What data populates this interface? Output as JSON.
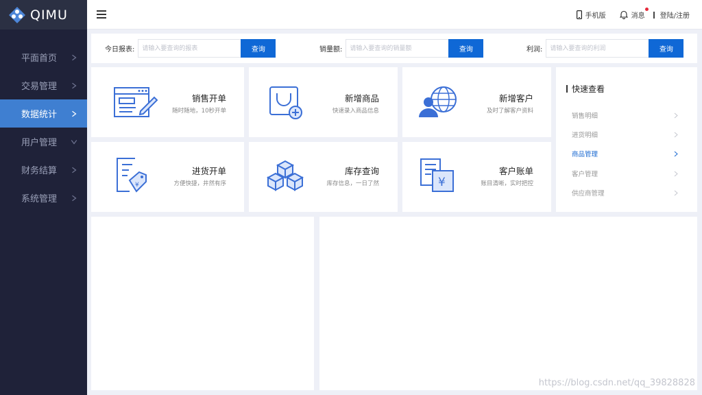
{
  "brand": {
    "name": "QIMU"
  },
  "sidebar": {
    "items": [
      {
        "label": "平面首页",
        "chevron": "right"
      },
      {
        "label": "交易管理",
        "chevron": "right"
      },
      {
        "label": "数据统计",
        "chevron": "right"
      },
      {
        "label": "用户管理",
        "chevron": "down"
      },
      {
        "label": "财务结算",
        "chevron": "right"
      },
      {
        "label": "系统管理",
        "chevron": "right"
      }
    ],
    "active_index": 2
  },
  "header": {
    "mobile_label": "手机版",
    "messages_label": "消息",
    "login_label": "登陆/注册"
  },
  "search": {
    "today_label": "今日报表:",
    "today_placeholder": "请输入要查询的报表",
    "sales_label": "销量额:",
    "sales_placeholder": "请输入要查询的销量额",
    "profit_label": "利润:",
    "profit_placeholder": "请输入要查询的利润",
    "button_label": "查询"
  },
  "cards": [
    {
      "title": "销售开单",
      "desc": "随时随地，10秒开单",
      "icon": "sales-order-icon"
    },
    {
      "title": "新增商品",
      "desc": "快速录入商品信息",
      "icon": "shopping-bag-add-icon"
    },
    {
      "title": "新增客户",
      "desc": "及时了解客户资料",
      "icon": "customer-globe-icon"
    },
    {
      "title": "进货开单",
      "desc": "方便快捷，井然有序",
      "icon": "purchase-tag-icon"
    },
    {
      "title": "库存查询",
      "desc": "库存信息，一日了然",
      "icon": "inventory-boxes-icon"
    },
    {
      "title": "客户账单",
      "desc": "账目清晰，实时把控",
      "icon": "customer-bill-icon"
    }
  ],
  "quick": {
    "title": "快速查看",
    "items": [
      "销售明细",
      "进货明细",
      "商品管理",
      "客户管理",
      "供应商管理"
    ],
    "active_index": 2
  },
  "watermark": "https://blog.csdn.net/qq_39828828",
  "colors": {
    "sidebar": "#1f2239",
    "accent": "#0f68d6",
    "active_nav": "#3f7fd1",
    "icon": "#3b6fd6"
  }
}
